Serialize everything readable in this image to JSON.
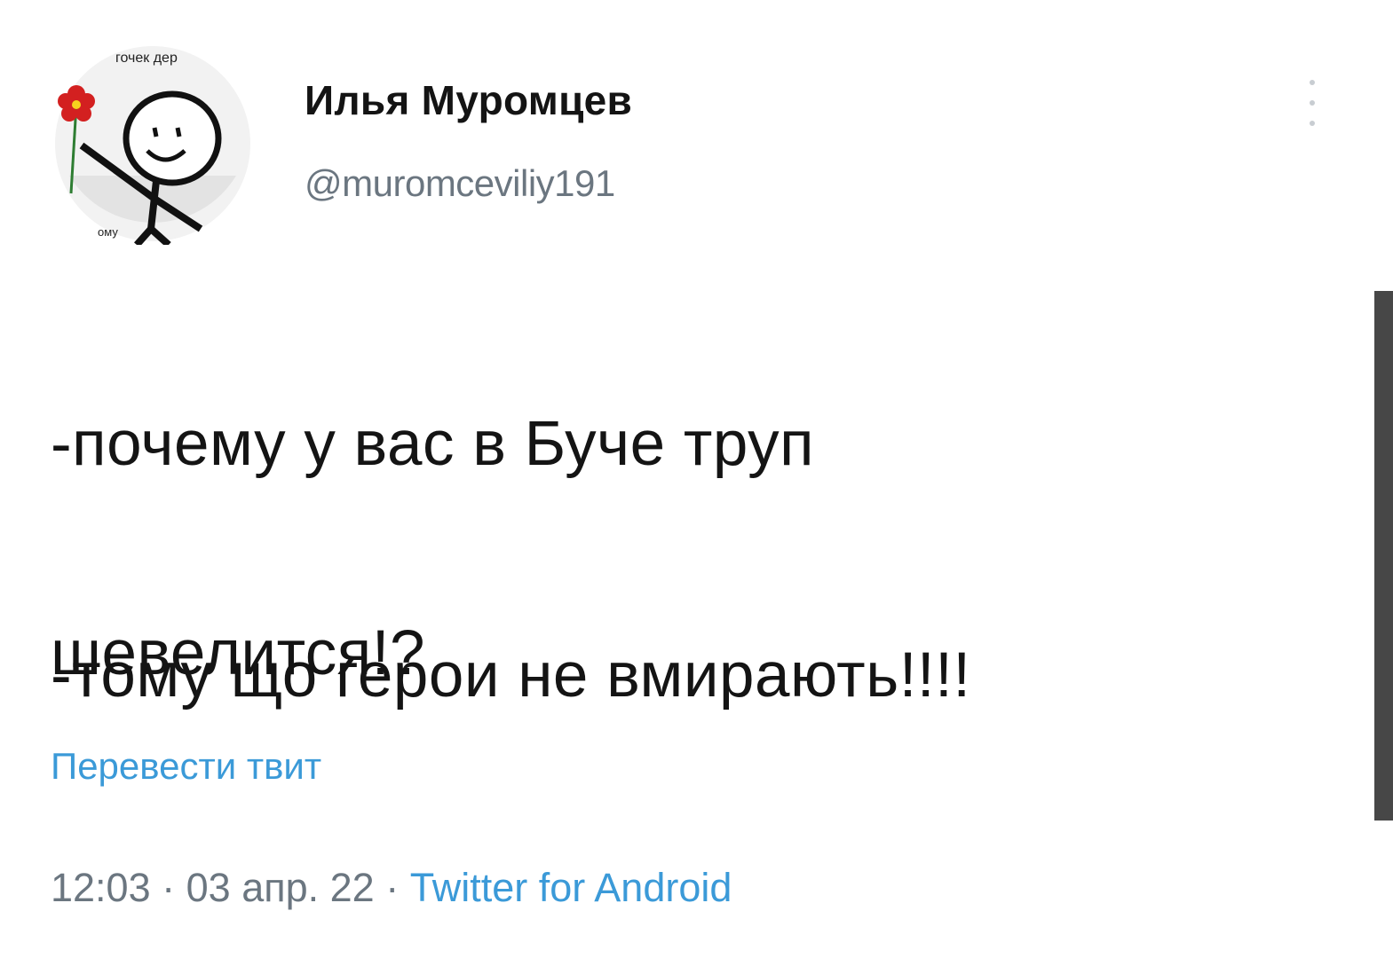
{
  "tweet": {
    "author": {
      "display_name": "Илья Муромцев",
      "handle": "@muromceviliy191",
      "avatar_caption_top": "гочек дер",
      "avatar_caption_bottom": "ому",
      "avatar_icon": "stickman-with-flower-icon"
    },
    "text_line1": "-почему у вас в Буче труп",
    "text_line2": "шевелится!?",
    "text_line3": "-тому що герои не вмирають!!!!",
    "translate_label": "Перевести твит",
    "time": "12:03",
    "separator": "·",
    "date": "03 апр. 22",
    "source": "Twitter for Android"
  },
  "colors": {
    "text": "#141414",
    "secondary": "#6b7680",
    "link": "#3b9ad8",
    "scrollbar": "#474747"
  }
}
